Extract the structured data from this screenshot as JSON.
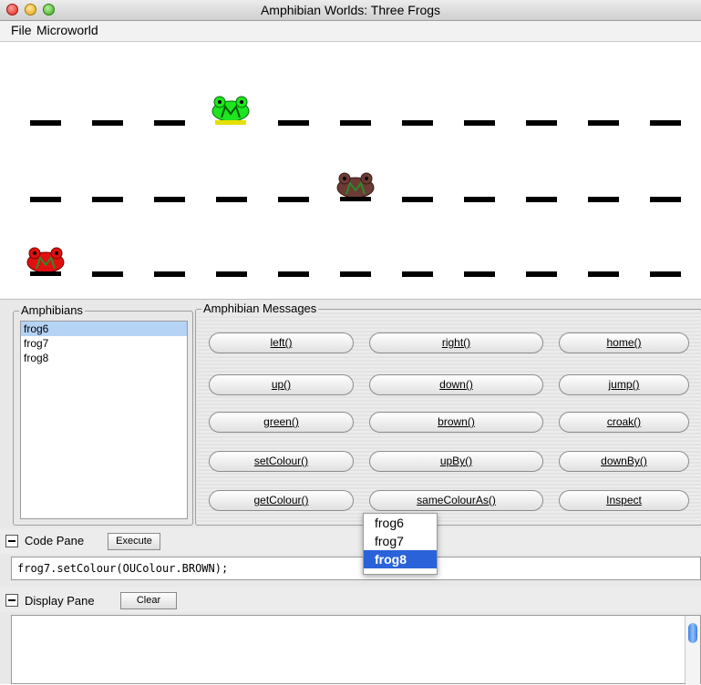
{
  "window": {
    "title": "Amphibian Worlds: Three Frogs"
  },
  "menu": [
    {
      "label": "File"
    },
    {
      "label": "Microworld"
    }
  ],
  "world": {
    "frogs": [
      {
        "name": "frog6",
        "color": "#1ee61e",
        "base_color": "#e6e000"
      },
      {
        "name": "frog7",
        "color": "#6b3b34",
        "base_color": "#000000"
      },
      {
        "name": "frog8",
        "color": "#e01010",
        "base_color": "#000000"
      }
    ]
  },
  "amphibians": {
    "label": "Amphibians",
    "items": [
      "frog6",
      "frog7",
      "frog8"
    ],
    "selected": "frog6"
  },
  "messages": {
    "label": "Amphibian Messages",
    "buttons": [
      "left()",
      "right()",
      "home()",
      "up()",
      "down()",
      "jump()",
      "green()",
      "brown()",
      "croak()",
      "setColour()",
      "upBy()",
      "downBy()",
      "getColour()",
      "sameColourAs()",
      "Inspect"
    ]
  },
  "code_pane": {
    "label": "Code Pane",
    "execute_label": "Execute",
    "code": "frog7.setColour(OUColour.BROWN);"
  },
  "display_pane": {
    "label": "Display Pane",
    "clear_label": "Clear"
  },
  "popup": {
    "items": [
      "frog6",
      "frog7",
      "frog8"
    ],
    "selected": "frog8"
  }
}
